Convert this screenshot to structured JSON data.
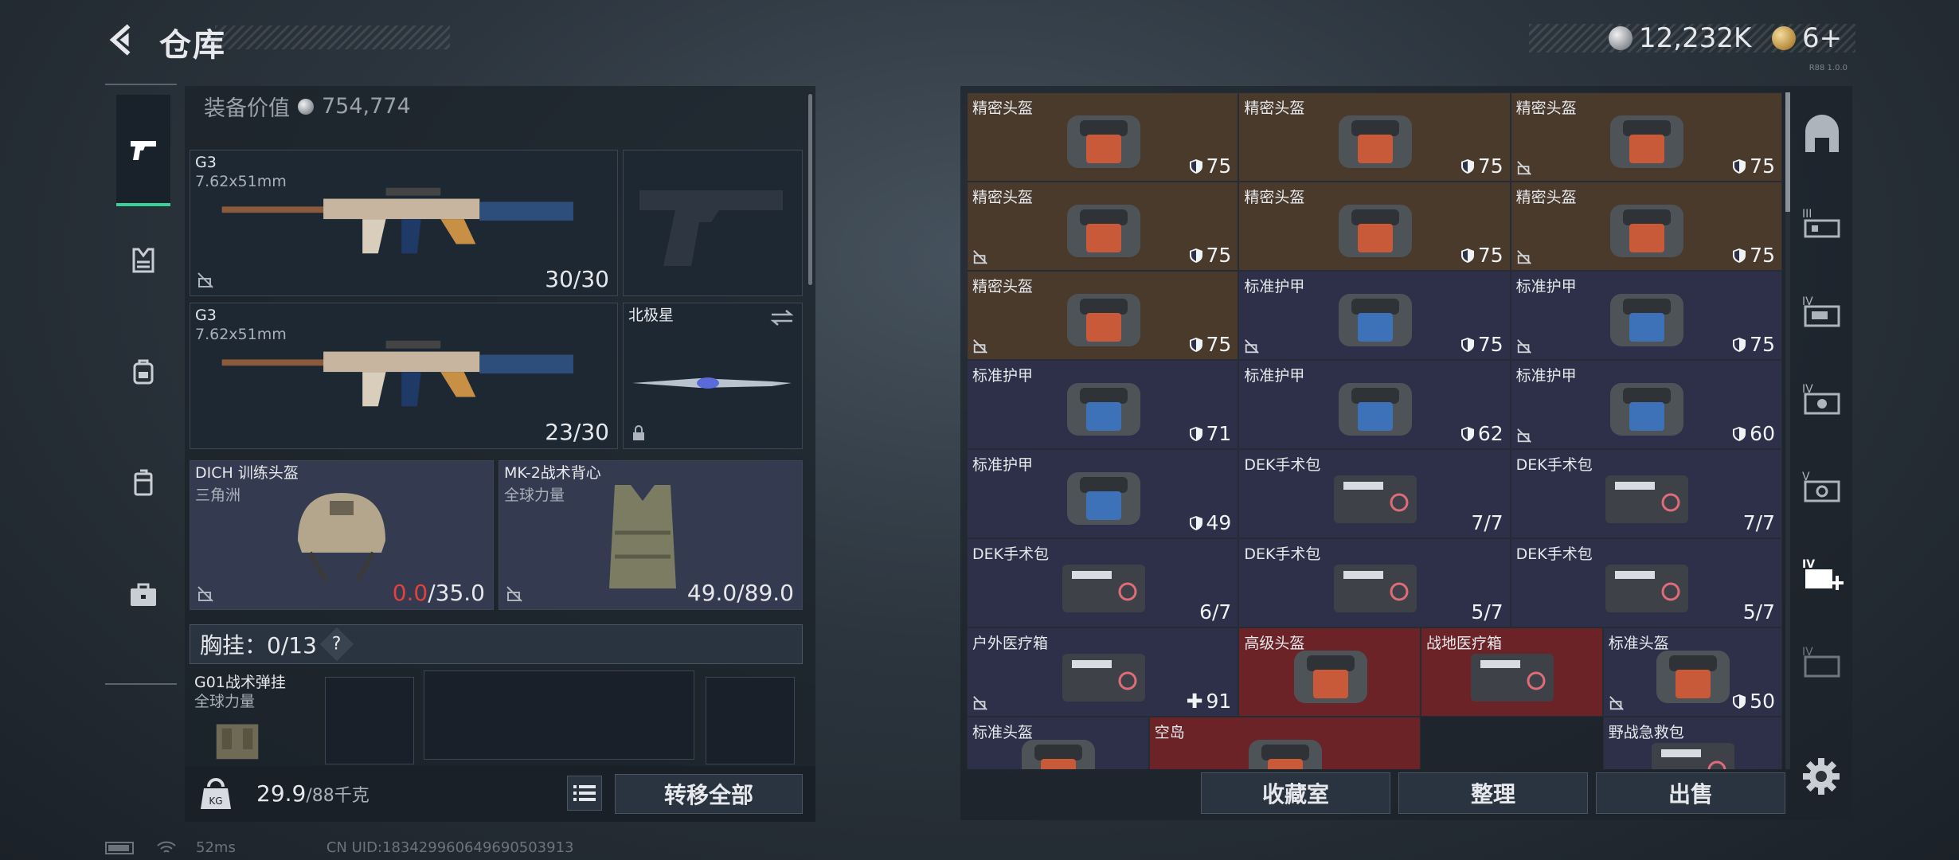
{
  "header": {
    "title": "仓库",
    "currency_silver": "12,232K",
    "currency_gold": "6+",
    "version": "R88 1.0.0"
  },
  "colors": {
    "accent_green": "#39d19a",
    "damage_red": "#e3413b",
    "rare_red": "#6b2327",
    "epic_brown": "#4a3a2c",
    "common_navy": "#2d3048"
  },
  "left_nav": {
    "items": [
      {
        "name": "weapons",
        "icon": "pistol-icon",
        "active": true
      },
      {
        "name": "vest",
        "icon": "chest-rig-icon",
        "active": false
      },
      {
        "name": "backpack",
        "icon": "backpack-icon",
        "active": false
      },
      {
        "name": "container",
        "icon": "case-icon",
        "active": false
      },
      {
        "name": "briefcase",
        "icon": "briefcase-icon",
        "active": false
      }
    ]
  },
  "loadout": {
    "value_label": "装备价值",
    "value": "754,774",
    "primary1": {
      "name": "G3",
      "caliber": "7.62x51mm",
      "ammo": "30/30"
    },
    "primary2": {
      "name": "G3",
      "caliber": "7.62x51mm",
      "ammo": "23/30"
    },
    "pistol": {
      "name": ""
    },
    "melee": {
      "name": "北极星"
    },
    "helmet": {
      "name": "DICH 训练头盔",
      "faction": "三角洲",
      "durability_current": "0.0",
      "durability_max": "/35.0"
    },
    "armor": {
      "name": "MK-2战术背心",
      "faction": "全球力量",
      "durability": "49.0/89.0"
    },
    "rig": {
      "label": "胸挂：0/13",
      "help": "?",
      "item_name": "G01战术弹挂",
      "item_faction": "全球力量"
    },
    "weight": "29.9",
    "weight_max": "/88千克",
    "transfer_all": "转移全部"
  },
  "storage": {
    "cells": [
      {
        "name": "精密头盔",
        "count": "75",
        "kind": "shield",
        "bg": "brown",
        "locked": false
      },
      {
        "name": "精密头盔",
        "count": "75",
        "kind": "shield",
        "bg": "brown",
        "locked": false
      },
      {
        "name": "精密头盔",
        "count": "75",
        "kind": "shield",
        "bg": "brown",
        "locked": true
      },
      {
        "name": "精密头盔",
        "count": "75",
        "kind": "shield",
        "bg": "brown",
        "locked": true
      },
      {
        "name": "精密头盔",
        "count": "75",
        "kind": "shield",
        "bg": "brown",
        "locked": false
      },
      {
        "name": "精密头盔",
        "count": "75",
        "kind": "shield",
        "bg": "brown",
        "locked": true
      },
      {
        "name": "精密头盔",
        "count": "75",
        "kind": "shield",
        "bg": "brown",
        "locked": true
      },
      {
        "name": "标准护甲",
        "count": "75",
        "kind": "shield",
        "bg": "navy",
        "locked": true
      },
      {
        "name": "标准护甲",
        "count": "75",
        "kind": "shield",
        "bg": "navy",
        "locked": true
      },
      {
        "name": "标准护甲",
        "count": "71",
        "kind": "shield",
        "bg": "navy",
        "locked": false
      },
      {
        "name": "标准护甲",
        "count": "62",
        "kind": "shield",
        "bg": "navy",
        "locked": false
      },
      {
        "name": "标准护甲",
        "count": "60",
        "kind": "shield",
        "bg": "navy",
        "locked": true
      },
      {
        "name": "标准护甲",
        "count": "49",
        "kind": "shield",
        "bg": "navy",
        "locked": false
      },
      {
        "name": "DEK手术包",
        "count": "7/7",
        "kind": "plain",
        "bg": "navy",
        "locked": false
      },
      {
        "name": "DEK手术包",
        "count": "7/7",
        "kind": "plain",
        "bg": "navy",
        "locked": false
      },
      {
        "name": "DEK手术包",
        "count": "6/7",
        "kind": "plain",
        "bg": "navy",
        "locked": false
      },
      {
        "name": "DEK手术包",
        "count": "5/7",
        "kind": "plain",
        "bg": "navy",
        "locked": false
      },
      {
        "name": "DEK手术包",
        "count": "5/7",
        "kind": "plain",
        "bg": "navy",
        "locked": false
      },
      {
        "name": "户外医疗箱",
        "count": "91",
        "kind": "plus",
        "bg": "navy",
        "locked": true
      },
      {
        "name": "高级头盔",
        "count": "",
        "kind": "plain",
        "bg": "red",
        "locked": false
      },
      {
        "name": "战地医疗箱",
        "count": "",
        "kind": "plain",
        "bg": "red",
        "locked": false
      },
      {
        "name": "标准头盔",
        "count": "50",
        "kind": "shield",
        "bg": "navy",
        "locked": true
      },
      {
        "name": "标准头盔",
        "count": "",
        "kind": "plain",
        "bg": "navy",
        "locked": false
      },
      {
        "name": "空岛",
        "count": "",
        "kind": "plain",
        "bg": "red",
        "locked": false
      },
      {
        "name": "野战急救包",
        "count": "",
        "kind": "plain",
        "bg": "navy",
        "locked": false
      }
    ],
    "buttons": {
      "collection": "收藏室",
      "organize": "整理",
      "sell": "出售"
    }
  },
  "right_nav": {
    "items": [
      {
        "icon": "vault-icon"
      },
      {
        "icon": "storage-iii-icon"
      },
      {
        "icon": "storage-iv-icon"
      },
      {
        "icon": "storage-iv-2-icon"
      },
      {
        "icon": "storage-v-icon"
      },
      {
        "icon": "storage-iv-add-icon"
      },
      {
        "icon": "storage-iv-3-icon"
      }
    ],
    "settings": "gear-icon"
  },
  "status": {
    "ping": "52ms",
    "uid": "CN UID:183429960649690503913"
  }
}
